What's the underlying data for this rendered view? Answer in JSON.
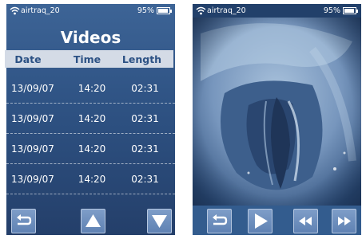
{
  "status_bar": {
    "network": "airtraq_20",
    "battery_percent": "95%",
    "battery_level": 0.95
  },
  "videos_screen": {
    "title": "Videos",
    "columns": [
      "Date",
      "Time",
      "Length"
    ],
    "rows": [
      {
        "date": "13/09/07",
        "time": "14:20",
        "length": "02:31"
      },
      {
        "date": "13/09/07",
        "time": "14:20",
        "length": "02:31"
      },
      {
        "date": "13/09/07",
        "time": "14:20",
        "length": "02:31"
      },
      {
        "date": "13/09/07",
        "time": "14:20",
        "length": "02:31"
      }
    ],
    "buttons": [
      "back-icon",
      "up-arrow-icon",
      "down-arrow-icon"
    ]
  },
  "player_screen": {
    "buttons": [
      "back-icon",
      "play-icon",
      "rewind-icon",
      "fast-forward-icon"
    ]
  },
  "colors": {
    "screen_blue": "#2e5283",
    "header_bg": "#d4dbe6",
    "header_text": "#2c5184",
    "button_blue": "#6f90be"
  }
}
